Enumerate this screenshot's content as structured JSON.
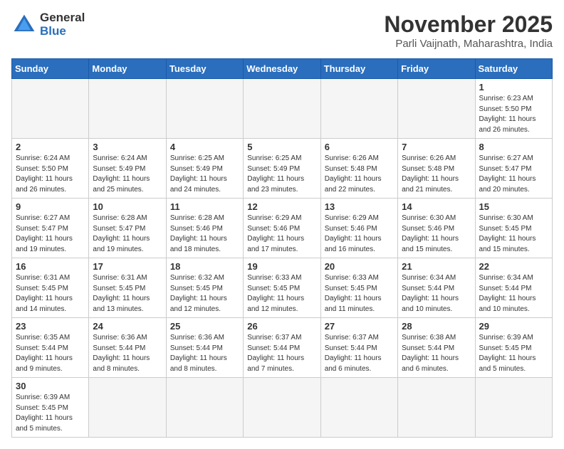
{
  "header": {
    "logo_line1": "General",
    "logo_line2": "Blue",
    "month": "November 2025",
    "location": "Parli Vaijnath, Maharashtra, India"
  },
  "weekdays": [
    "Sunday",
    "Monday",
    "Tuesday",
    "Wednesday",
    "Thursday",
    "Friday",
    "Saturday"
  ],
  "weeks": [
    [
      {
        "day": "",
        "info": ""
      },
      {
        "day": "",
        "info": ""
      },
      {
        "day": "",
        "info": ""
      },
      {
        "day": "",
        "info": ""
      },
      {
        "day": "",
        "info": ""
      },
      {
        "day": "",
        "info": ""
      },
      {
        "day": "1",
        "info": "Sunrise: 6:23 AM\nSunset: 5:50 PM\nDaylight: 11 hours\nand 26 minutes."
      }
    ],
    [
      {
        "day": "2",
        "info": "Sunrise: 6:24 AM\nSunset: 5:50 PM\nDaylight: 11 hours\nand 26 minutes."
      },
      {
        "day": "3",
        "info": "Sunrise: 6:24 AM\nSunset: 5:49 PM\nDaylight: 11 hours\nand 25 minutes."
      },
      {
        "day": "4",
        "info": "Sunrise: 6:25 AM\nSunset: 5:49 PM\nDaylight: 11 hours\nand 24 minutes."
      },
      {
        "day": "5",
        "info": "Sunrise: 6:25 AM\nSunset: 5:49 PM\nDaylight: 11 hours\nand 23 minutes."
      },
      {
        "day": "6",
        "info": "Sunrise: 6:26 AM\nSunset: 5:48 PM\nDaylight: 11 hours\nand 22 minutes."
      },
      {
        "day": "7",
        "info": "Sunrise: 6:26 AM\nSunset: 5:48 PM\nDaylight: 11 hours\nand 21 minutes."
      },
      {
        "day": "8",
        "info": "Sunrise: 6:27 AM\nSunset: 5:47 PM\nDaylight: 11 hours\nand 20 minutes."
      }
    ],
    [
      {
        "day": "9",
        "info": "Sunrise: 6:27 AM\nSunset: 5:47 PM\nDaylight: 11 hours\nand 19 minutes."
      },
      {
        "day": "10",
        "info": "Sunrise: 6:28 AM\nSunset: 5:47 PM\nDaylight: 11 hours\nand 19 minutes."
      },
      {
        "day": "11",
        "info": "Sunrise: 6:28 AM\nSunset: 5:46 PM\nDaylight: 11 hours\nand 18 minutes."
      },
      {
        "day": "12",
        "info": "Sunrise: 6:29 AM\nSunset: 5:46 PM\nDaylight: 11 hours\nand 17 minutes."
      },
      {
        "day": "13",
        "info": "Sunrise: 6:29 AM\nSunset: 5:46 PM\nDaylight: 11 hours\nand 16 minutes."
      },
      {
        "day": "14",
        "info": "Sunrise: 6:30 AM\nSunset: 5:46 PM\nDaylight: 11 hours\nand 15 minutes."
      },
      {
        "day": "15",
        "info": "Sunrise: 6:30 AM\nSunset: 5:45 PM\nDaylight: 11 hours\nand 15 minutes."
      }
    ],
    [
      {
        "day": "16",
        "info": "Sunrise: 6:31 AM\nSunset: 5:45 PM\nDaylight: 11 hours\nand 14 minutes."
      },
      {
        "day": "17",
        "info": "Sunrise: 6:31 AM\nSunset: 5:45 PM\nDaylight: 11 hours\nand 13 minutes."
      },
      {
        "day": "18",
        "info": "Sunrise: 6:32 AM\nSunset: 5:45 PM\nDaylight: 11 hours\nand 12 minutes."
      },
      {
        "day": "19",
        "info": "Sunrise: 6:33 AM\nSunset: 5:45 PM\nDaylight: 11 hours\nand 12 minutes."
      },
      {
        "day": "20",
        "info": "Sunrise: 6:33 AM\nSunset: 5:45 PM\nDaylight: 11 hours\nand 11 minutes."
      },
      {
        "day": "21",
        "info": "Sunrise: 6:34 AM\nSunset: 5:44 PM\nDaylight: 11 hours\nand 10 minutes."
      },
      {
        "day": "22",
        "info": "Sunrise: 6:34 AM\nSunset: 5:44 PM\nDaylight: 11 hours\nand 10 minutes."
      }
    ],
    [
      {
        "day": "23",
        "info": "Sunrise: 6:35 AM\nSunset: 5:44 PM\nDaylight: 11 hours\nand 9 minutes."
      },
      {
        "day": "24",
        "info": "Sunrise: 6:36 AM\nSunset: 5:44 PM\nDaylight: 11 hours\nand 8 minutes."
      },
      {
        "day": "25",
        "info": "Sunrise: 6:36 AM\nSunset: 5:44 PM\nDaylight: 11 hours\nand 8 minutes."
      },
      {
        "day": "26",
        "info": "Sunrise: 6:37 AM\nSunset: 5:44 PM\nDaylight: 11 hours\nand 7 minutes."
      },
      {
        "day": "27",
        "info": "Sunrise: 6:37 AM\nSunset: 5:44 PM\nDaylight: 11 hours\nand 6 minutes."
      },
      {
        "day": "28",
        "info": "Sunrise: 6:38 AM\nSunset: 5:44 PM\nDaylight: 11 hours\nand 6 minutes."
      },
      {
        "day": "29",
        "info": "Sunrise: 6:39 AM\nSunset: 5:45 PM\nDaylight: 11 hours\nand 5 minutes."
      }
    ],
    [
      {
        "day": "30",
        "info": "Sunrise: 6:39 AM\nSunset: 5:45 PM\nDaylight: 11 hours\nand 5 minutes."
      },
      {
        "day": "",
        "info": ""
      },
      {
        "day": "",
        "info": ""
      },
      {
        "day": "",
        "info": ""
      },
      {
        "day": "",
        "info": ""
      },
      {
        "day": "",
        "info": ""
      },
      {
        "day": "",
        "info": ""
      }
    ]
  ]
}
